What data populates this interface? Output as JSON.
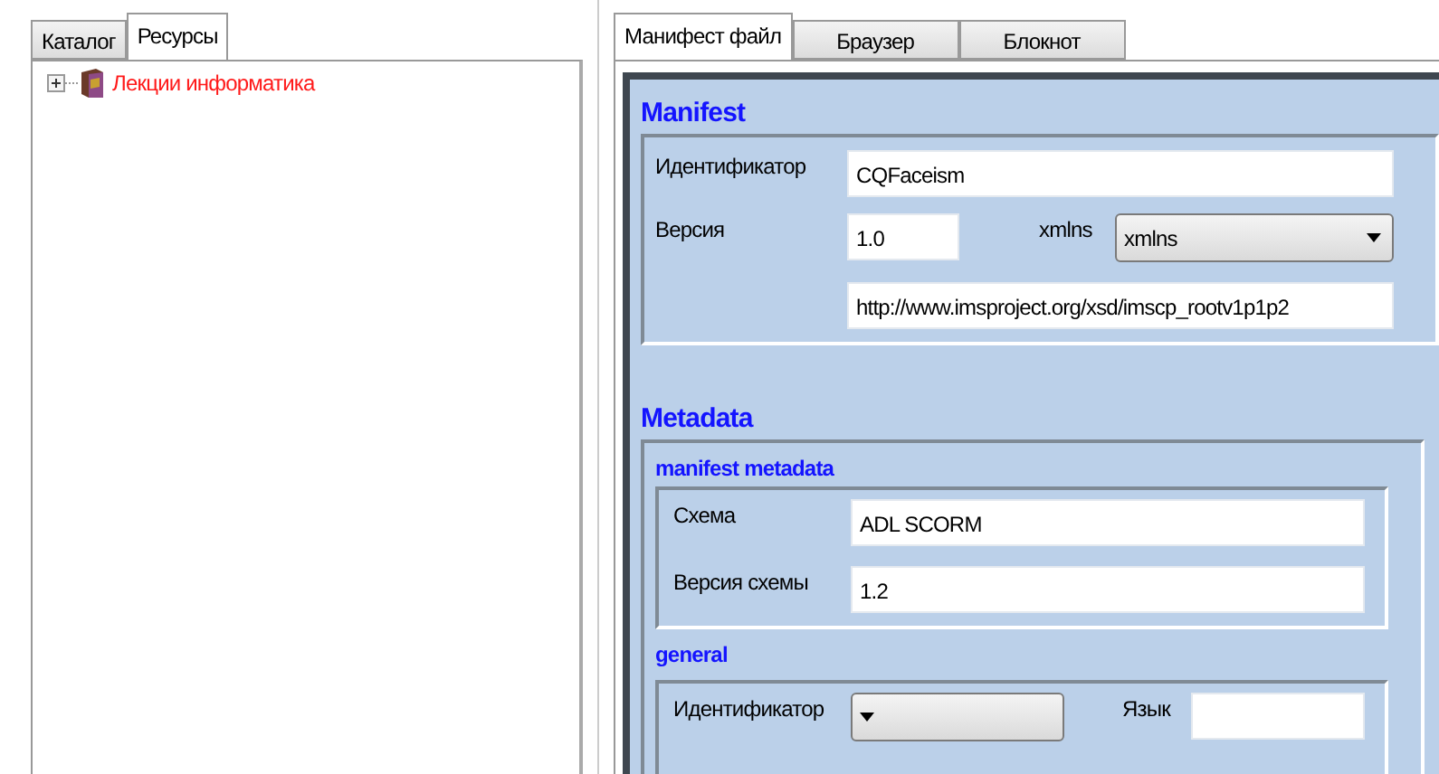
{
  "left_tabs": [
    {
      "label": "Каталог",
      "selected": false
    },
    {
      "label": "Ресурсы",
      "selected": true
    }
  ],
  "tree": [
    {
      "label": "Лекции информатика",
      "expanded": false
    }
  ],
  "right_tabs": [
    {
      "label": "Манифест файл",
      "selected": true
    },
    {
      "label": "Браузер",
      "selected": false
    },
    {
      "label": "Блокнот",
      "selected": false
    }
  ],
  "manifest": {
    "title": "Manifest",
    "identifier_label": "Идентификатор",
    "identifier": "CQFaceism",
    "version_label": "Версия",
    "version": "1.0",
    "xmlns_label": "xmlns",
    "xmlns_select": "xmlns",
    "xmlns_url": "http://www.imsproject.org/xsd/imscp_rootv1p1p2"
  },
  "metadata": {
    "title": "Metadata",
    "manifest_metadata": {
      "title": "manifest metadata",
      "schema_label": "Схема",
      "schema": "ADL SCORM",
      "schema_version_label": "Версия схемы",
      "schema_version": "1.2"
    },
    "general": {
      "title": "general",
      "identifier_label": "Идентификатор",
      "language_label": "Язык"
    }
  }
}
